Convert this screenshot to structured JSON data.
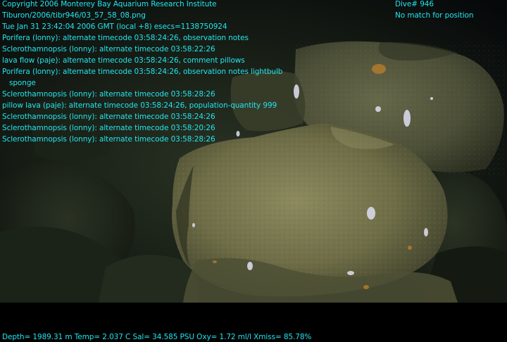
{
  "header": {
    "copyright": "Copyright 2006 Monterey Bay Aquarium Research Institute",
    "filepath": "Tiburon/2006/tibr946/03_57_58_08.png",
    "datetime": "Tue Jan 31 23:42:04 2006 GMT (local +8)  esecs=1138750924",
    "dive": "Dive# 946",
    "position_status": "No match for position"
  },
  "annotations": [
    "Porifera (lonny): alternate timecode 03:58:24:26, observation notes",
    "Sclerothamnopsis (lonny): alternate timecode 03:58:22:26",
    "lava flow (paje): alternate timecode 03:58:24:26, comment pillows",
    "Porifera (lonny): alternate timecode 03:58:24:26, observation notes lightbulb",
    "sponge",
    "Sclerothamnopsis (lonny): alternate timecode 03:58:28:26",
    "pillow lava (paje): alternate timecode 03:58:24:26, population-quantity 999",
    "Sclerothamnopsis (lonny): alternate timecode 03:58:24:26",
    "Sclerothamnopsis (lonny): alternate timecode 03:58:20:26",
    "Sclerothamnopsis (lonny): alternate timecode 03:58:28:26"
  ],
  "footer": {
    "telemetry": "Depth= 1989.31 m  Temp= 2.037 C  Sal= 34.585 PSU  Oxy= 1.72 ml/l  Xmiss= 85.78%"
  },
  "colors": {
    "overlay_text": "#22e5ee",
    "background": "#000000"
  }
}
